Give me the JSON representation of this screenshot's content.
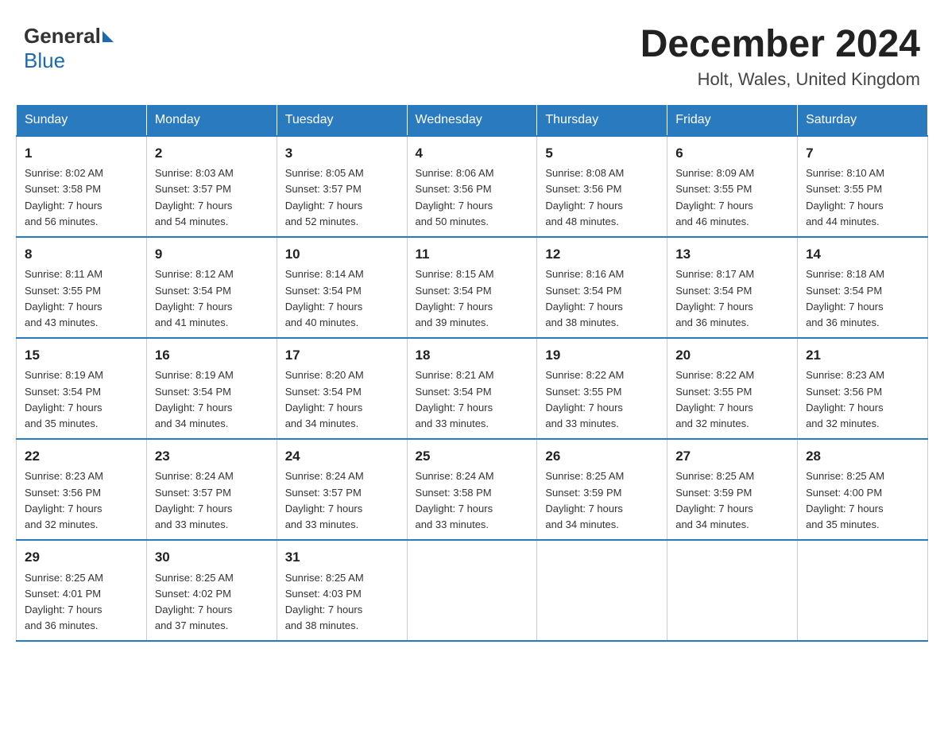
{
  "header": {
    "logo_general": "General",
    "logo_blue": "Blue",
    "title": "December 2024",
    "subtitle": "Holt, Wales, United Kingdom"
  },
  "days_of_week": [
    "Sunday",
    "Monday",
    "Tuesday",
    "Wednesday",
    "Thursday",
    "Friday",
    "Saturday"
  ],
  "weeks": [
    [
      {
        "day": "1",
        "info": "Sunrise: 8:02 AM\nSunset: 3:58 PM\nDaylight: 7 hours\nand 56 minutes."
      },
      {
        "day": "2",
        "info": "Sunrise: 8:03 AM\nSunset: 3:57 PM\nDaylight: 7 hours\nand 54 minutes."
      },
      {
        "day": "3",
        "info": "Sunrise: 8:05 AM\nSunset: 3:57 PM\nDaylight: 7 hours\nand 52 minutes."
      },
      {
        "day": "4",
        "info": "Sunrise: 8:06 AM\nSunset: 3:56 PM\nDaylight: 7 hours\nand 50 minutes."
      },
      {
        "day": "5",
        "info": "Sunrise: 8:08 AM\nSunset: 3:56 PM\nDaylight: 7 hours\nand 48 minutes."
      },
      {
        "day": "6",
        "info": "Sunrise: 8:09 AM\nSunset: 3:55 PM\nDaylight: 7 hours\nand 46 minutes."
      },
      {
        "day": "7",
        "info": "Sunrise: 8:10 AM\nSunset: 3:55 PM\nDaylight: 7 hours\nand 44 minutes."
      }
    ],
    [
      {
        "day": "8",
        "info": "Sunrise: 8:11 AM\nSunset: 3:55 PM\nDaylight: 7 hours\nand 43 minutes."
      },
      {
        "day": "9",
        "info": "Sunrise: 8:12 AM\nSunset: 3:54 PM\nDaylight: 7 hours\nand 41 minutes."
      },
      {
        "day": "10",
        "info": "Sunrise: 8:14 AM\nSunset: 3:54 PM\nDaylight: 7 hours\nand 40 minutes."
      },
      {
        "day": "11",
        "info": "Sunrise: 8:15 AM\nSunset: 3:54 PM\nDaylight: 7 hours\nand 39 minutes."
      },
      {
        "day": "12",
        "info": "Sunrise: 8:16 AM\nSunset: 3:54 PM\nDaylight: 7 hours\nand 38 minutes."
      },
      {
        "day": "13",
        "info": "Sunrise: 8:17 AM\nSunset: 3:54 PM\nDaylight: 7 hours\nand 36 minutes."
      },
      {
        "day": "14",
        "info": "Sunrise: 8:18 AM\nSunset: 3:54 PM\nDaylight: 7 hours\nand 36 minutes."
      }
    ],
    [
      {
        "day": "15",
        "info": "Sunrise: 8:19 AM\nSunset: 3:54 PM\nDaylight: 7 hours\nand 35 minutes."
      },
      {
        "day": "16",
        "info": "Sunrise: 8:19 AM\nSunset: 3:54 PM\nDaylight: 7 hours\nand 34 minutes."
      },
      {
        "day": "17",
        "info": "Sunrise: 8:20 AM\nSunset: 3:54 PM\nDaylight: 7 hours\nand 34 minutes."
      },
      {
        "day": "18",
        "info": "Sunrise: 8:21 AM\nSunset: 3:54 PM\nDaylight: 7 hours\nand 33 minutes."
      },
      {
        "day": "19",
        "info": "Sunrise: 8:22 AM\nSunset: 3:55 PM\nDaylight: 7 hours\nand 33 minutes."
      },
      {
        "day": "20",
        "info": "Sunrise: 8:22 AM\nSunset: 3:55 PM\nDaylight: 7 hours\nand 32 minutes."
      },
      {
        "day": "21",
        "info": "Sunrise: 8:23 AM\nSunset: 3:56 PM\nDaylight: 7 hours\nand 32 minutes."
      }
    ],
    [
      {
        "day": "22",
        "info": "Sunrise: 8:23 AM\nSunset: 3:56 PM\nDaylight: 7 hours\nand 32 minutes."
      },
      {
        "day": "23",
        "info": "Sunrise: 8:24 AM\nSunset: 3:57 PM\nDaylight: 7 hours\nand 33 minutes."
      },
      {
        "day": "24",
        "info": "Sunrise: 8:24 AM\nSunset: 3:57 PM\nDaylight: 7 hours\nand 33 minutes."
      },
      {
        "day": "25",
        "info": "Sunrise: 8:24 AM\nSunset: 3:58 PM\nDaylight: 7 hours\nand 33 minutes."
      },
      {
        "day": "26",
        "info": "Sunrise: 8:25 AM\nSunset: 3:59 PM\nDaylight: 7 hours\nand 34 minutes."
      },
      {
        "day": "27",
        "info": "Sunrise: 8:25 AM\nSunset: 3:59 PM\nDaylight: 7 hours\nand 34 minutes."
      },
      {
        "day": "28",
        "info": "Sunrise: 8:25 AM\nSunset: 4:00 PM\nDaylight: 7 hours\nand 35 minutes."
      }
    ],
    [
      {
        "day": "29",
        "info": "Sunrise: 8:25 AM\nSunset: 4:01 PM\nDaylight: 7 hours\nand 36 minutes."
      },
      {
        "day": "30",
        "info": "Sunrise: 8:25 AM\nSunset: 4:02 PM\nDaylight: 7 hours\nand 37 minutes."
      },
      {
        "day": "31",
        "info": "Sunrise: 8:25 AM\nSunset: 4:03 PM\nDaylight: 7 hours\nand 38 minutes."
      },
      null,
      null,
      null,
      null
    ]
  ]
}
